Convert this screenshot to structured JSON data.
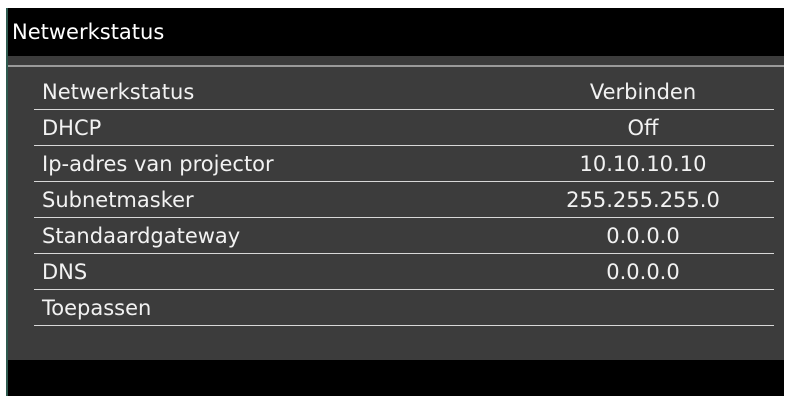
{
  "window": {
    "title": "Netwerkstatus"
  },
  "colors": {
    "panel_background": "#3c3c3c",
    "title_bar_background": "#000000",
    "text": "#f2f2f2",
    "row_divider": "#d8d8d8",
    "accent_border": "#2e5a4f"
  },
  "menu": {
    "items": [
      {
        "label": "Netwerkstatus",
        "value": "Verbinden"
      },
      {
        "label": "DHCP",
        "value": "Off"
      },
      {
        "label": "Ip-adres van projector",
        "value": "10.10.10.10"
      },
      {
        "label": "Subnetmasker",
        "value": "255.255.255.0"
      },
      {
        "label": "Standaardgateway",
        "value": "0.0.0.0"
      },
      {
        "label": "DNS",
        "value": "0.0.0.0"
      },
      {
        "label": "Toepassen",
        "value": ""
      }
    ]
  }
}
